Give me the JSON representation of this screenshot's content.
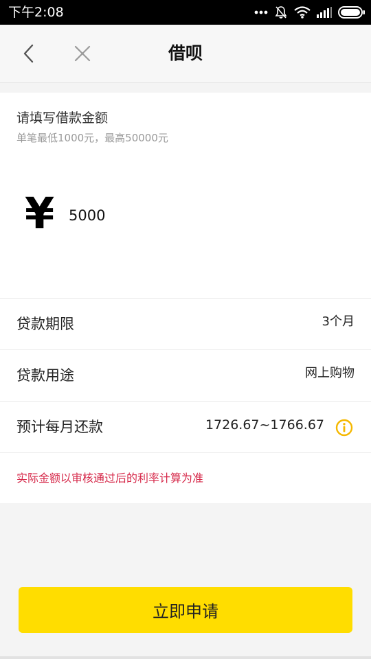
{
  "status_bar": {
    "time": "下午2:08"
  },
  "navbar": {
    "title": "借呗",
    "back_icon": "chevron-left-icon",
    "close_icon": "close-icon"
  },
  "amount_section": {
    "title": "请填写借款金额",
    "hint": "单笔最低1000元，最高50000元",
    "currency_symbol": "¥",
    "amount_value": "5000"
  },
  "rows": [
    {
      "label": "贷款期限",
      "value": "3个月"
    },
    {
      "label": "贷款用途",
      "value": "网上购物"
    },
    {
      "label": "预计每月还款",
      "value": "1726.67~1766.67"
    }
  ],
  "notice": "实际金额以审核通过后的利率计算为准",
  "apply_button": "立即申请",
  "colors": {
    "accent": "#ffdd00",
    "notice": "#d6294a",
    "info_icon": "#f5b800"
  }
}
